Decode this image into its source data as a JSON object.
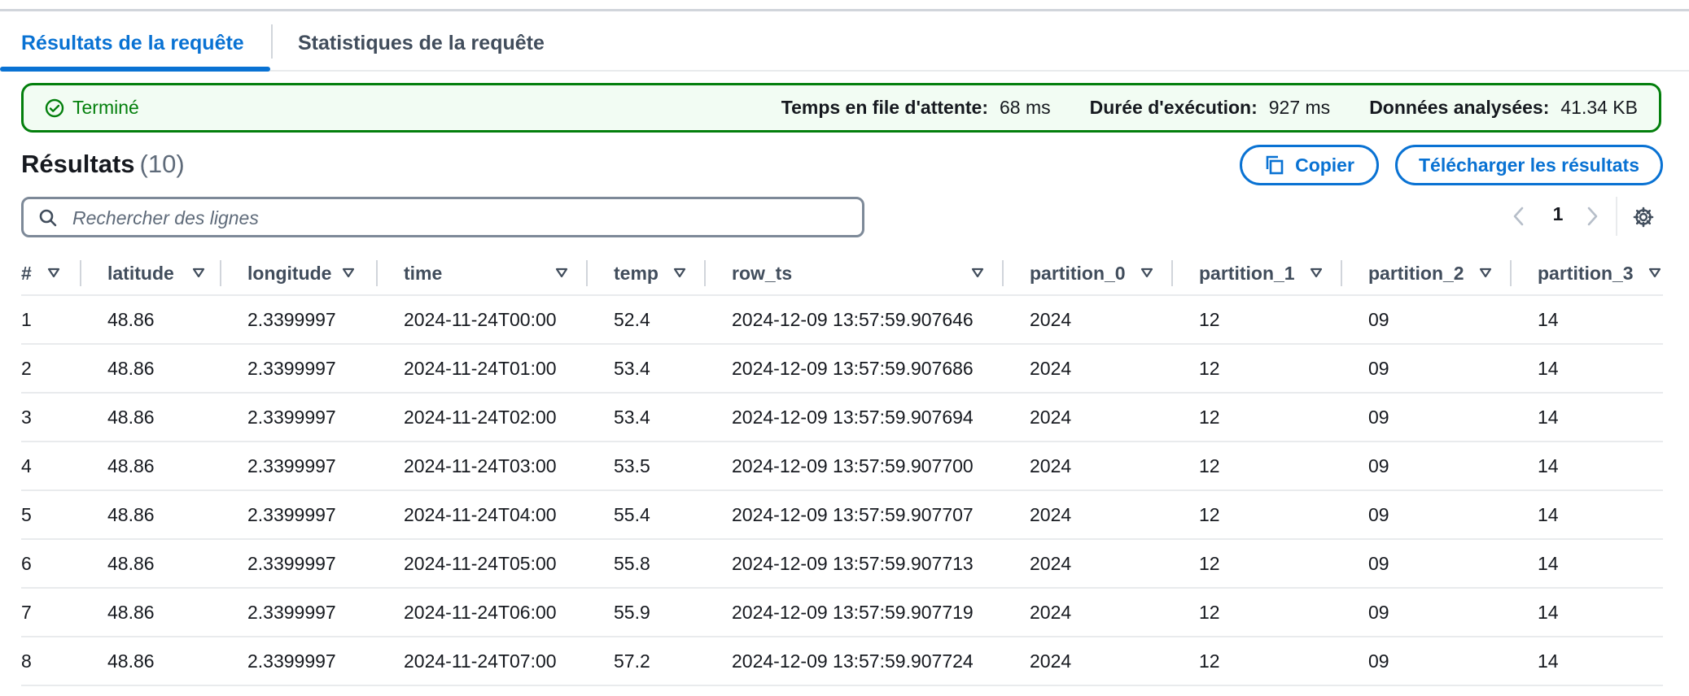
{
  "tabs": {
    "results": "Résultats de la requête",
    "stats": "Statistiques de la requête"
  },
  "status": {
    "label": "Terminé",
    "queue_label": "Temps en file d'attente:",
    "queue_value": "68 ms",
    "exec_label": "Durée d'exécution:",
    "exec_value": "927 ms",
    "scanned_label": "Données analysées:",
    "scanned_value": "41.34 KB"
  },
  "results": {
    "title": "Résultats",
    "count": "(10)",
    "copy_label": "Copier",
    "download_label": "Télécharger les résultats"
  },
  "search": {
    "placeholder": "Rechercher des lignes"
  },
  "pagination": {
    "page": "1"
  },
  "table": {
    "columns": [
      "#",
      "latitude",
      "longitude",
      "time",
      "temp",
      "row_ts",
      "partition_0",
      "partition_1",
      "partition_2",
      "partition_3"
    ],
    "rows": [
      [
        "1",
        "48.86",
        "2.3399997",
        "2024-11-24T00:00",
        "52.4",
        "2024-12-09 13:57:59.907646",
        "2024",
        "12",
        "09",
        "14"
      ],
      [
        "2",
        "48.86",
        "2.3399997",
        "2024-11-24T01:00",
        "53.4",
        "2024-12-09 13:57:59.907686",
        "2024",
        "12",
        "09",
        "14"
      ],
      [
        "3",
        "48.86",
        "2.3399997",
        "2024-11-24T02:00",
        "53.4",
        "2024-12-09 13:57:59.907694",
        "2024",
        "12",
        "09",
        "14"
      ],
      [
        "4",
        "48.86",
        "2.3399997",
        "2024-11-24T03:00",
        "53.5",
        "2024-12-09 13:57:59.907700",
        "2024",
        "12",
        "09",
        "14"
      ],
      [
        "5",
        "48.86",
        "2.3399997",
        "2024-11-24T04:00",
        "55.4",
        "2024-12-09 13:57:59.907707",
        "2024",
        "12",
        "09",
        "14"
      ],
      [
        "6",
        "48.86",
        "2.3399997",
        "2024-11-24T05:00",
        "55.8",
        "2024-12-09 13:57:59.907713",
        "2024",
        "12",
        "09",
        "14"
      ],
      [
        "7",
        "48.86",
        "2.3399997",
        "2024-11-24T06:00",
        "55.9",
        "2024-12-09 13:57:59.907719",
        "2024",
        "12",
        "09",
        "14"
      ],
      [
        "8",
        "48.86",
        "2.3399997",
        "2024-11-24T07:00",
        "57.2",
        "2024-12-09 13:57:59.907724",
        "2024",
        "12",
        "09",
        "14"
      ]
    ]
  },
  "colors": {
    "accent": "#0972d3",
    "success": "#037f0c",
    "success_bg": "#f2fcf3"
  }
}
